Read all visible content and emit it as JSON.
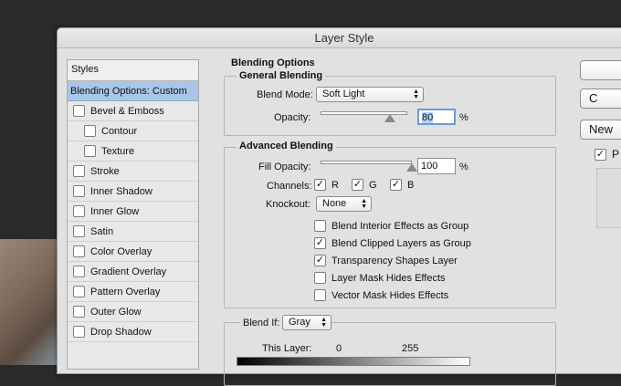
{
  "dialog": {
    "title": "Layer Style"
  },
  "styles_panel": {
    "header": "Styles",
    "items": [
      {
        "label": "Blending Options: Custom",
        "checkbox": false,
        "checked": false,
        "selected": true,
        "sub": false
      },
      {
        "label": "Bevel & Emboss",
        "checkbox": true,
        "checked": false,
        "selected": false,
        "sub": false
      },
      {
        "label": "Contour",
        "checkbox": true,
        "checked": false,
        "selected": false,
        "sub": true
      },
      {
        "label": "Texture",
        "checkbox": true,
        "checked": false,
        "selected": false,
        "sub": true
      },
      {
        "label": "Stroke",
        "checkbox": true,
        "checked": false,
        "selected": false,
        "sub": false
      },
      {
        "label": "Inner Shadow",
        "checkbox": true,
        "checked": false,
        "selected": false,
        "sub": false
      },
      {
        "label": "Inner Glow",
        "checkbox": true,
        "checked": false,
        "selected": false,
        "sub": false
      },
      {
        "label": "Satin",
        "checkbox": true,
        "checked": false,
        "selected": false,
        "sub": false
      },
      {
        "label": "Color Overlay",
        "checkbox": true,
        "checked": false,
        "selected": false,
        "sub": false
      },
      {
        "label": "Gradient Overlay",
        "checkbox": true,
        "checked": false,
        "selected": false,
        "sub": false
      },
      {
        "label": "Pattern Overlay",
        "checkbox": true,
        "checked": false,
        "selected": false,
        "sub": false
      },
      {
        "label": "Outer Glow",
        "checkbox": true,
        "checked": false,
        "selected": false,
        "sub": false
      },
      {
        "label": "Drop Shadow",
        "checkbox": true,
        "checked": false,
        "selected": false,
        "sub": false
      }
    ]
  },
  "blending_options": {
    "title": "Blending Options",
    "general": {
      "title": "General Blending",
      "blend_mode_label": "Blend Mode:",
      "blend_mode_value": "Soft Light",
      "opacity_label": "Opacity:",
      "opacity_value": "80",
      "opacity_unit": "%",
      "opacity_fraction": 0.8
    },
    "advanced": {
      "title": "Advanced Blending",
      "fill_opacity_label": "Fill Opacity:",
      "fill_opacity_value": "100",
      "fill_opacity_unit": "%",
      "fill_opacity_fraction": 1.0,
      "channels_label": "Channels:",
      "channel_r": "R",
      "channel_g": "G",
      "channel_b": "B",
      "knockout_label": "Knockout:",
      "knockout_value": "None",
      "options": [
        {
          "label": "Blend Interior Effects as Group",
          "checked": false
        },
        {
          "label": "Blend Clipped Layers as Group",
          "checked": true
        },
        {
          "label": "Transparency Shapes Layer",
          "checked": true
        },
        {
          "label": "Layer Mask Hides Effects",
          "checked": false
        },
        {
          "label": "Vector Mask Hides Effects",
          "checked": false
        }
      ]
    },
    "blend_if": {
      "label": "Blend If:",
      "value": "Gray",
      "this_layer_label": "This Layer:",
      "this_layer_min": "0",
      "this_layer_max": "255"
    }
  },
  "right_buttons": {
    "ok": "",
    "cancel": "C",
    "new_style": "New",
    "preview": "P"
  },
  "colors": {
    "selection": "#a9c6e8",
    "focus_ring": "#6a9ad6"
  }
}
